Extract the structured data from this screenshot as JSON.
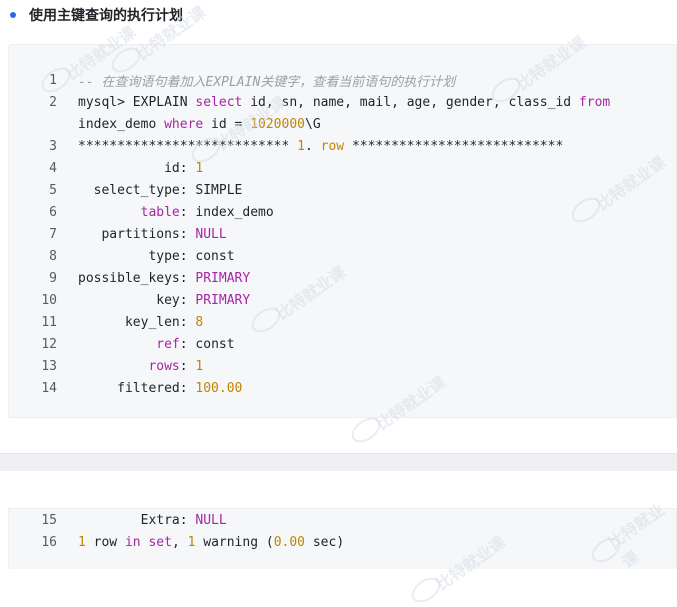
{
  "heading": "使用主键查询的执行计划",
  "watermark_text": "比特就业课",
  "code_block_1": {
    "lines": [
      {
        "no": "1",
        "tokens": [
          {
            "t": "-- 在查询语句着加入EXPLAIN关键字，查看当前语句的执行计划",
            "k": "comment"
          }
        ]
      },
      {
        "no": "2",
        "tokens": [
          {
            "t": "mysql> EXPLAIN ",
            "k": "plain"
          },
          {
            "t": "select",
            "k": "kw"
          },
          {
            "t": " id, sn, name, mail, age, gender, class_id ",
            "k": "plain"
          },
          {
            "t": "from",
            "k": "kw"
          }
        ]
      },
      {
        "no": "",
        "tokens": [
          {
            "t": "index_demo ",
            "k": "plain"
          },
          {
            "t": "where",
            "k": "kw"
          },
          {
            "t": " id = ",
            "k": "plain"
          },
          {
            "t": "1020000",
            "k": "num"
          },
          {
            "t": "\\G",
            "k": "plain"
          }
        ]
      },
      {
        "no": "3",
        "tokens": [
          {
            "t": "*************************** ",
            "k": "plain"
          },
          {
            "t": "1",
            "k": "num"
          },
          {
            "t": ". ",
            "k": "plain"
          },
          {
            "t": "row",
            "k": "num"
          },
          {
            "t": " ***************************",
            "k": "plain"
          }
        ]
      },
      {
        "no": "4",
        "tokens": [
          {
            "t": "           id: ",
            "k": "plain"
          },
          {
            "t": "1",
            "k": "num"
          }
        ]
      },
      {
        "no": "5",
        "tokens": [
          {
            "t": "  select_type: SIMPLE",
            "k": "plain"
          }
        ]
      },
      {
        "no": "6",
        "tokens": [
          {
            "t": "        ",
            "k": "plain"
          },
          {
            "t": "table",
            "k": "kw"
          },
          {
            "t": ": index_demo",
            "k": "plain"
          }
        ]
      },
      {
        "no": "7",
        "tokens": [
          {
            "t": "   partitions: ",
            "k": "plain"
          },
          {
            "t": "NULL",
            "k": "kw"
          }
        ]
      },
      {
        "no": "8",
        "tokens": [
          {
            "t": "         type: const",
            "k": "plain"
          }
        ]
      },
      {
        "no": "9",
        "tokens": [
          {
            "t": "possible_keys: ",
            "k": "plain"
          },
          {
            "t": "PRIMARY",
            "k": "kw"
          }
        ]
      },
      {
        "no": "10",
        "tokens": [
          {
            "t": "          key: ",
            "k": "plain"
          },
          {
            "t": "PRIMARY",
            "k": "kw"
          }
        ]
      },
      {
        "no": "11",
        "tokens": [
          {
            "t": "      key_len: ",
            "k": "plain"
          },
          {
            "t": "8",
            "k": "num"
          }
        ]
      },
      {
        "no": "12",
        "tokens": [
          {
            "t": "          ",
            "k": "plain"
          },
          {
            "t": "ref",
            "k": "kw"
          },
          {
            "t": ": const",
            "k": "plain"
          }
        ]
      },
      {
        "no": "13",
        "tokens": [
          {
            "t": "         ",
            "k": "plain"
          },
          {
            "t": "rows",
            "k": "kw"
          },
          {
            "t": ": ",
            "k": "plain"
          },
          {
            "t": "1",
            "k": "num"
          }
        ]
      },
      {
        "no": "14",
        "tokens": [
          {
            "t": "     filtered: ",
            "k": "plain"
          },
          {
            "t": "100.00",
            "k": "num"
          }
        ]
      }
    ]
  },
  "code_block_2": {
    "lines": [
      {
        "no": "15",
        "tokens": [
          {
            "t": "        Extra: ",
            "k": "plain"
          },
          {
            "t": "NULL",
            "k": "kw"
          }
        ]
      },
      {
        "no": "16",
        "tokens": [
          {
            "t": "1",
            "k": "num"
          },
          {
            "t": " row ",
            "k": "plain"
          },
          {
            "t": "in",
            "k": "kw"
          },
          {
            "t": " ",
            "k": "plain"
          },
          {
            "t": "set",
            "k": "kw"
          },
          {
            "t": ", ",
            "k": "plain"
          },
          {
            "t": "1",
            "k": "num"
          },
          {
            "t": " warning (",
            "k": "plain"
          },
          {
            "t": "0.00",
            "k": "num"
          },
          {
            "t": " sec)",
            "k": "plain"
          }
        ]
      }
    ]
  }
}
